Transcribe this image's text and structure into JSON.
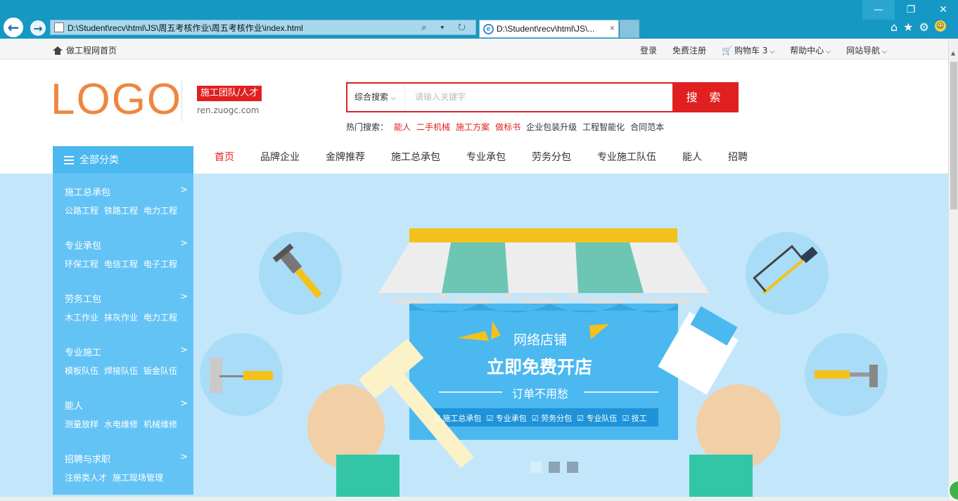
{
  "browser": {
    "address": "D:\\Student\\recv\\html\\JS\\周五考核作业\\周五考核作业\\index.html",
    "tab_title": "D:\\Student\\recv\\html\\JS\\...",
    "tab_close": "×",
    "addr_tools": "⌕ ▾ ↻"
  },
  "topbar": {
    "home": "做工程网首页",
    "login": "登录",
    "register": "免费注册",
    "cart": "购物车 3",
    "help": "帮助中心",
    "sitenav": "网站导航"
  },
  "header": {
    "logo": "LOGO",
    "badge": "施工团队/人才",
    "domain": "ren.zuogc.com"
  },
  "search": {
    "category": "综合搜索",
    "placeholder": "请输入关键字",
    "button": "搜 索",
    "hot_label": "热门搜索：",
    "hot_red": [
      "能人",
      "二手机械",
      "施工方案",
      "做标书"
    ],
    "hot_normal": [
      "企业包装升级",
      "工程智能化",
      "合同范本"
    ]
  },
  "nav": {
    "all_categories": "全部分类",
    "links": [
      "首页",
      "品牌企业",
      "金牌推荐",
      "施工总承包",
      "专业承包",
      "劳务分包",
      "专业施工队伍",
      "能人",
      "招聘"
    ]
  },
  "sidebar": [
    {
      "title": "施工总承包",
      "subs": [
        "公路工程",
        "铁路工程",
        "电力工程"
      ]
    },
    {
      "title": "专业承包",
      "subs": [
        "环保工程",
        "电信工程",
        "电子工程"
      ]
    },
    {
      "title": "劳务工包",
      "subs": [
        "木工作业",
        "抹灰作业",
        "电力工程"
      ]
    },
    {
      "title": "专业施工",
      "subs": [
        "模板队伍",
        "焊接队伍",
        "钣金队伍"
      ]
    },
    {
      "title": "能人",
      "subs": [
        "测量放样",
        "水电维修",
        "机械维修"
      ]
    },
    {
      "title": "招聘与求职",
      "subs": [
        "注册类人才",
        "施工现场管理"
      ]
    }
  ],
  "banner": {
    "line1": "网络店铺",
    "line2": "立即免费开店",
    "line3": "订单不用愁",
    "tags": [
      "施工总承包",
      "专业承包",
      "劳务分包",
      "专业队伍",
      "技工"
    ],
    "current_slide": 1,
    "slides": 3
  },
  "colors": {
    "brand_red": "#e02020",
    "sky": "#c3e6fb",
    "sidebar": "#64c3f5",
    "logo": "#ef8640"
  }
}
